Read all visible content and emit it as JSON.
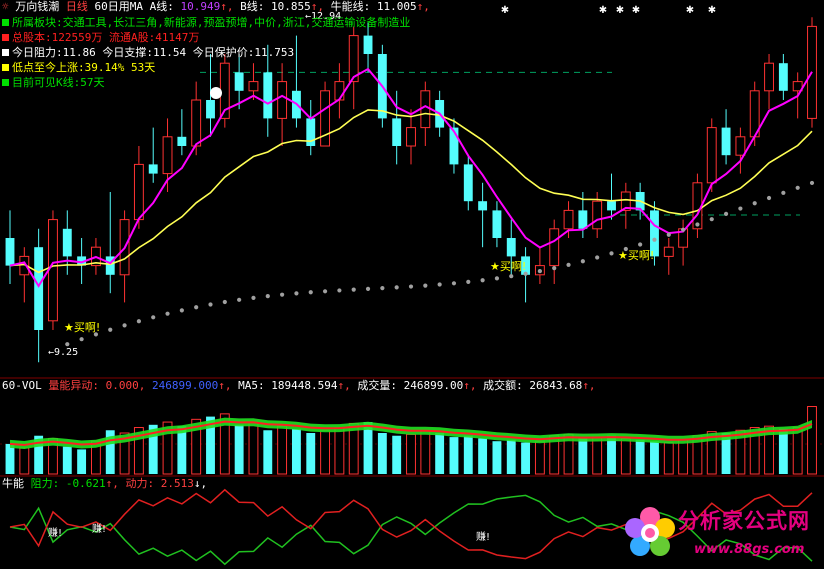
{
  "colors": {
    "bg": "#000000",
    "up": "#ff3232",
    "down": "#54fcfc",
    "ma_short": "#ff00ff",
    "ma_long": "#ffff54",
    "dots": "#a0a0a0",
    "resistance": "#00a060",
    "grid": "#800000",
    "text_white": "#ffffff",
    "text_yellow": "#ffff00",
    "text_purple": "#c040ff",
    "text_magenta": "#ff50ff",
    "text_green": "#00e000",
    "brand": "#e4007f"
  },
  "header": {
    "stock_name": "万向钱潮",
    "period": "日线",
    "ma_label": "60日用MA",
    "a_label": "A线:",
    "a_value": "10.949",
    "b_label": "B线:",
    "b_value": "10.855",
    "c_label": "牛能线:",
    "c_value": "11.005",
    "arrow": "↑,",
    "arrow2": "↑,"
  },
  "info_panel": [
    {
      "color": "#00e000",
      "label": "所属板块:",
      "value": "交通工具,长江三角,新能源,预盈预增,中价,浙江,交通运输设备制造业"
    },
    {
      "color": "#ff2020",
      "label": "总股本:",
      "value": "122559万   流通A股:41147万"
    },
    {
      "color": "#ffffff",
      "label": "今日阻力:",
      "value": "11.86   今日支撑:11.54   今日保护价:11.753"
    },
    {
      "color": "#ffff00",
      "label": "低点至今上涨:",
      "value": "39.14%    53天"
    },
    {
      "color": "#00e000",
      "label": "目前可见K线:",
      "value": "57天"
    }
  ],
  "annotations": {
    "buy": "★买啊!",
    "high_price": "12.94",
    "low_price": "9.25",
    "earn": "赚!"
  },
  "volume_panel": {
    "title": "60-VOL",
    "f1_label": "量能异动:",
    "f1_value": "0.000,",
    "f2_value": "246899.000",
    "ma5_label": "MA5:",
    "ma5_value": "189448.594",
    "vol_label": "成交量:",
    "vol_value": "246899.00",
    "amt_label": "成交额:",
    "amt_value": "26843.68",
    "arrow": "↑,"
  },
  "osc_panel": {
    "title": "牛能",
    "res_label": "阻力:",
    "res_value": "-0.621",
    "pow_label": "动力:",
    "pow_value": "2.513",
    "arrow_up": "↑,",
    "arrow_down": "↓,"
  },
  "logo": {
    "title": "分析家公式网",
    "url": "www.88gs.com"
  },
  "chart_data": {
    "type": "candlestick",
    "price_range": [
      9.1,
      13.1
    ],
    "candles": [
      {
        "o": 10.6,
        "h": 10.9,
        "l": 10.1,
        "c": 10.3
      },
      {
        "o": 10.2,
        "h": 10.5,
        "l": 9.9,
        "c": 10.4
      },
      {
        "o": 10.5,
        "h": 10.7,
        "l": 9.25,
        "c": 9.6
      },
      {
        "o": 9.7,
        "h": 10.9,
        "l": 9.6,
        "c": 10.8
      },
      {
        "o": 10.7,
        "h": 10.9,
        "l": 10.2,
        "c": 10.4
      },
      {
        "o": 10.4,
        "h": 10.6,
        "l": 10.1,
        "c": 10.3
      },
      {
        "o": 10.3,
        "h": 10.6,
        "l": 10.2,
        "c": 10.5
      },
      {
        "o": 10.4,
        "h": 11.1,
        "l": 10.0,
        "c": 10.2
      },
      {
        "o": 10.2,
        "h": 10.9,
        "l": 9.9,
        "c": 10.8
      },
      {
        "o": 10.8,
        "h": 11.6,
        "l": 10.7,
        "c": 11.4
      },
      {
        "o": 11.4,
        "h": 11.8,
        "l": 11.2,
        "c": 11.3
      },
      {
        "o": 11.3,
        "h": 11.9,
        "l": 11.1,
        "c": 11.7
      },
      {
        "o": 11.7,
        "h": 12.0,
        "l": 11.5,
        "c": 11.6
      },
      {
        "o": 11.6,
        "h": 12.3,
        "l": 11.5,
        "c": 12.1
      },
      {
        "o": 12.1,
        "h": 12.6,
        "l": 11.7,
        "c": 11.9
      },
      {
        "o": 11.9,
        "h": 12.6,
        "l": 11.8,
        "c": 12.5
      },
      {
        "o": 12.4,
        "h": 12.6,
        "l": 12.0,
        "c": 12.2
      },
      {
        "o": 12.2,
        "h": 12.5,
        "l": 12.1,
        "c": 12.3
      },
      {
        "o": 12.4,
        "h": 12.7,
        "l": 11.7,
        "c": 11.9
      },
      {
        "o": 11.9,
        "h": 12.5,
        "l": 11.6,
        "c": 12.3
      },
      {
        "o": 12.2,
        "h": 12.8,
        "l": 11.8,
        "c": 11.9
      },
      {
        "o": 11.9,
        "h": 12.1,
        "l": 11.5,
        "c": 11.6
      },
      {
        "o": 11.6,
        "h": 12.3,
        "l": 11.6,
        "c": 12.2
      },
      {
        "o": 12.1,
        "h": 12.5,
        "l": 11.9,
        "c": 12.3
      },
      {
        "o": 12.3,
        "h": 12.9,
        "l": 12.0,
        "c": 12.8
      },
      {
        "o": 12.8,
        "h": 12.94,
        "l": 12.4,
        "c": 12.6
      },
      {
        "o": 12.6,
        "h": 12.7,
        "l": 11.8,
        "c": 11.9
      },
      {
        "o": 11.9,
        "h": 12.2,
        "l": 11.4,
        "c": 11.6
      },
      {
        "o": 11.6,
        "h": 12.0,
        "l": 11.4,
        "c": 11.8
      },
      {
        "o": 11.8,
        "h": 12.3,
        "l": 11.6,
        "c": 12.2
      },
      {
        "o": 12.1,
        "h": 12.2,
        "l": 11.7,
        "c": 11.8
      },
      {
        "o": 11.8,
        "h": 11.9,
        "l": 11.3,
        "c": 11.4
      },
      {
        "o": 11.4,
        "h": 11.5,
        "l": 10.9,
        "c": 11.0
      },
      {
        "o": 11.0,
        "h": 11.2,
        "l": 10.5,
        "c": 10.9
      },
      {
        "o": 10.9,
        "h": 11.0,
        "l": 10.5,
        "c": 10.6
      },
      {
        "o": 10.6,
        "h": 10.8,
        "l": 10.2,
        "c": 10.4
      },
      {
        "o": 10.4,
        "h": 10.5,
        "l": 9.9,
        "c": 10.2
      },
      {
        "o": 10.2,
        "h": 10.5,
        "l": 10.1,
        "c": 10.3
      },
      {
        "o": 10.3,
        "h": 10.8,
        "l": 10.1,
        "c": 10.7
      },
      {
        "o": 10.7,
        "h": 11.0,
        "l": 10.6,
        "c": 10.9
      },
      {
        "o": 10.9,
        "h": 11.1,
        "l": 10.6,
        "c": 10.7
      },
      {
        "o": 10.7,
        "h": 11.1,
        "l": 10.6,
        "c": 11.0
      },
      {
        "o": 11.0,
        "h": 11.3,
        "l": 10.8,
        "c": 10.9
      },
      {
        "o": 10.9,
        "h": 11.2,
        "l": 10.7,
        "c": 11.1
      },
      {
        "o": 11.1,
        "h": 11.2,
        "l": 10.8,
        "c": 10.9
      },
      {
        "o": 10.9,
        "h": 11.0,
        "l": 10.3,
        "c": 10.4
      },
      {
        "o": 10.4,
        "h": 10.6,
        "l": 10.2,
        "c": 10.5
      },
      {
        "o": 10.5,
        "h": 10.8,
        "l": 10.3,
        "c": 10.7
      },
      {
        "o": 10.7,
        "h": 11.3,
        "l": 10.6,
        "c": 11.2
      },
      {
        "o": 11.2,
        "h": 11.9,
        "l": 11.1,
        "c": 11.8
      },
      {
        "o": 11.8,
        "h": 12.0,
        "l": 11.4,
        "c": 11.5
      },
      {
        "o": 11.5,
        "h": 11.8,
        "l": 11.3,
        "c": 11.7
      },
      {
        "o": 11.7,
        "h": 12.3,
        "l": 11.6,
        "c": 12.2
      },
      {
        "o": 12.2,
        "h": 12.6,
        "l": 12.0,
        "c": 12.5
      },
      {
        "o": 12.5,
        "h": 12.6,
        "l": 12.1,
        "c": 12.2
      },
      {
        "o": 12.2,
        "h": 12.4,
        "l": 11.9,
        "c": 12.3
      },
      {
        "o": 11.9,
        "h": 13.0,
        "l": 11.8,
        "c": 12.9
      }
    ],
    "volume": [
      110,
      95,
      140,
      130,
      100,
      90,
      120,
      160,
      150,
      170,
      180,
      190,
      175,
      200,
      210,
      220,
      180,
      190,
      160,
      175,
      165,
      150,
      160,
      170,
      185,
      190,
      150,
      140,
      145,
      160,
      150,
      135,
      140,
      130,
      120,
      125,
      115,
      120,
      140,
      145,
      130,
      135,
      140,
      130,
      125,
      120,
      115,
      125,
      140,
      155,
      150,
      160,
      170,
      175,
      165,
      170,
      246.9
    ],
    "volume_range": [
      0,
      300
    ]
  }
}
